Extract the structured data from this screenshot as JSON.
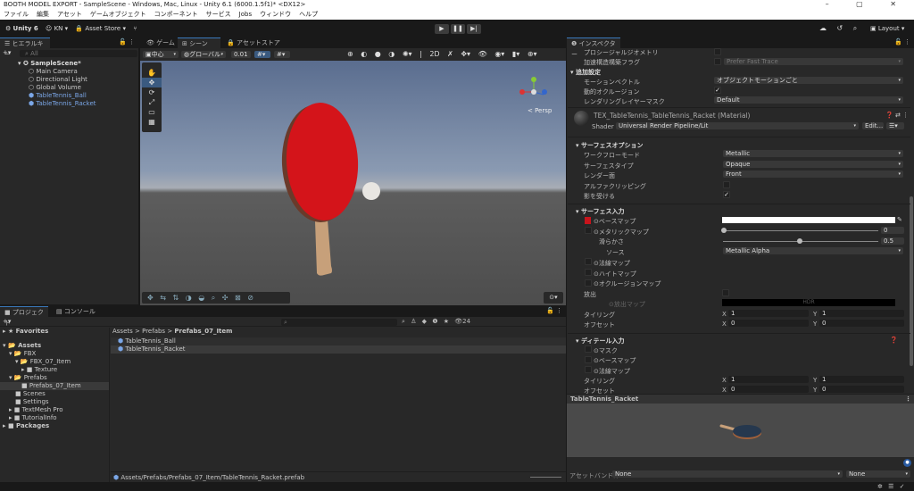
{
  "window": {
    "title": "BOOTH MODEL EXPORT - SampleScene - Windows, Mac, Linux - Unity 6.1 (6000.1.5f1)* <DX12>",
    "controls": "– ▢ ✕"
  },
  "menu": [
    "ファイル",
    "編集",
    "アセット",
    "ゲームオブジェクト",
    "コンポーネント",
    "サービス",
    "Jobs",
    "ウィンドウ",
    "ヘルプ"
  ],
  "toolbar": {
    "unity": "Unity 6",
    "account": "KN",
    "asset_store": "Asset Store",
    "layout": "Layout"
  },
  "hierarchy": {
    "tab": "ヒエラルキー",
    "search_placeholder": "All",
    "scene": "SampleScene*",
    "items": [
      "Main Camera",
      "Directional Light",
      "Global Volume",
      "TableTennis_Ball",
      "TableTennis_Racket"
    ]
  },
  "scene": {
    "tabs": [
      "ゲーム",
      "シーン",
      "アセットストア"
    ],
    "pivot": "中心",
    "space": "グローバル",
    "snap": "0.01",
    "persp": "< Persp"
  },
  "project": {
    "tabs": [
      "プロジェクト",
      "コンソール"
    ],
    "count": "24",
    "tree": [
      {
        "label": "Favorites",
        "indent": 0
      },
      {
        "label": "Assets",
        "indent": 0
      },
      {
        "label": "FBX",
        "indent": 1
      },
      {
        "label": "FBX_07_Item",
        "indent": 2
      },
      {
        "label": "Texture",
        "indent": 3
      },
      {
        "label": "Prefabs",
        "indent": 1
      },
      {
        "label": "Prefabs_07_Item",
        "indent": 2
      },
      {
        "label": "Scenes",
        "indent": 1
      },
      {
        "label": "Settings",
        "indent": 1
      },
      {
        "label": "TextMesh Pro",
        "indent": 1
      },
      {
        "label": "TutorialInfo",
        "indent": 1
      },
      {
        "label": "Packages",
        "indent": 0
      }
    ],
    "breadcrumb": [
      "Assets",
      "Prefabs",
      "Prefabs_07_Item"
    ],
    "files": [
      "TableTennis_Ball",
      "TableTennis_Racket"
    ],
    "path": "Assets/Prefabs/Prefabs_07_Item/TableTennis_Racket.prefab"
  },
  "inspector": {
    "tab": "インスペクター",
    "procedural": "プロシージャルジオメトリ",
    "accel": "加速構造構築フラグ",
    "accel_value": "Prefer Fast Trace",
    "additional": "追加設定",
    "motion": "モーションベクトル",
    "motion_value": "オブジェクトモーションごと",
    "occlusion": "動的オクルージョン",
    "layer_mask": "レンダリングレイヤーマスク",
    "layer_mask_value": "Default",
    "material": "TEX_TableTennis_TableTennis_Racket (Material)",
    "shader_label": "Shader",
    "shader": "Universal Render Pipeline/Lit",
    "edit": "Edit...",
    "surface_options": "サーフェスオプション",
    "workflow": "ワークフローモード",
    "workflow_value": "Metallic",
    "surface_type": "サーフェスタイプ",
    "surface_type_value": "Opaque",
    "render_face": "レンダー面",
    "render_face_value": "Front",
    "alpha_clip": "アルファクリッピング",
    "receive_shadows": "影を受ける",
    "surface_inputs": "サーフェス入力",
    "base_map": "ベースマップ",
    "metallic_map": "メタリックマップ",
    "metallic_value": "0",
    "smoothness": "滑らかさ",
    "smoothness_value": "0.5",
    "source": "ソース",
    "source_value": "Metallic Alpha",
    "normal_map": "法線マップ",
    "height_map": "ハイトマップ",
    "occlusion_map": "オクルージョンマップ",
    "emission": "放出",
    "emission_map": "放出マップ",
    "hdr": "HDR",
    "tiling": "タイリング",
    "offset": "オフセット",
    "x": "X",
    "y": "Y",
    "tiling_x": "1",
    "tiling_y": "1",
    "offset_x": "0",
    "offset_y": "0",
    "detail_inputs": "ディテール入力",
    "mask": "マスク",
    "detail_base": "ベースマップ",
    "detail_normal": "法線マップ",
    "d_tiling_x": "1",
    "d_tiling_y": "1",
    "d_offset_x": "0",
    "d_offset_y": "0",
    "preview_title": "TableTennis_Racket",
    "bundle_label": "アセットバンドル",
    "bundle_value": "None",
    "variant_value": "None"
  },
  "colors": {
    "accent": "#3a79bb",
    "racket_red": "#c8141c"
  }
}
